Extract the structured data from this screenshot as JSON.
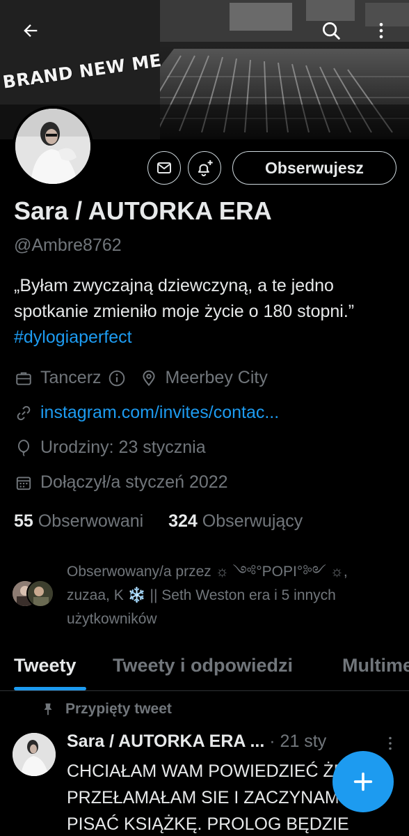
{
  "banner": {
    "overlay_text": "BRAND NEW ME"
  },
  "topbar": {
    "back_icon": "arrow-left-icon",
    "search_icon": "search-icon",
    "more_icon": "more-vertical-icon"
  },
  "profile": {
    "name": "Sara / AUTORKA ERA",
    "handle": "@Ambre8762",
    "bio_text": "„Byłam zwyczajną dziewczyną, a te jedno spotkanie zmieniło moje życie o 180 stopni.” ",
    "bio_hashtag": "#dylogiaperfect",
    "follow_button": "Obserwujesz",
    "category": "Tancerz",
    "location": "Meerbey City",
    "website": "instagram.com/invites/contac...",
    "birthday": "Urodziny: 23 stycznia",
    "joined": "Dołączył/a styczeń 2022",
    "following_count": "55",
    "following_label": "Obserwowani",
    "followers_count": "324",
    "followers_label": "Obserwujący",
    "followed_by": "Obserwowany/a przez ☼ ༺°POPI°༻ ☼, zuzaa, K ❄️ || Seth Weston era i 5 innych użytkowników"
  },
  "tabs": [
    {
      "label": "Tweety",
      "active": true
    },
    {
      "label": "Tweety i odpowiedzi",
      "active": false
    },
    {
      "label": "Multimedia",
      "active": false
    }
  ],
  "pinned_tweet": {
    "pinned_label": "Przypięty tweet",
    "author": "Sara / AUTORKA ERA ...",
    "date": "· 21 sty",
    "text": "CHCIAŁAM WAM POWIEDZIEĆ ŻE PRZEŁAMAŁAM SIE I ZACZYNAM PISAĆ KSIĄŻKĘ. PROLOG BĘDZIE"
  },
  "colors": {
    "accent": "#1d9bf0",
    "muted": "#71767b",
    "text": "#e7e9ea",
    "background": "#000000"
  }
}
